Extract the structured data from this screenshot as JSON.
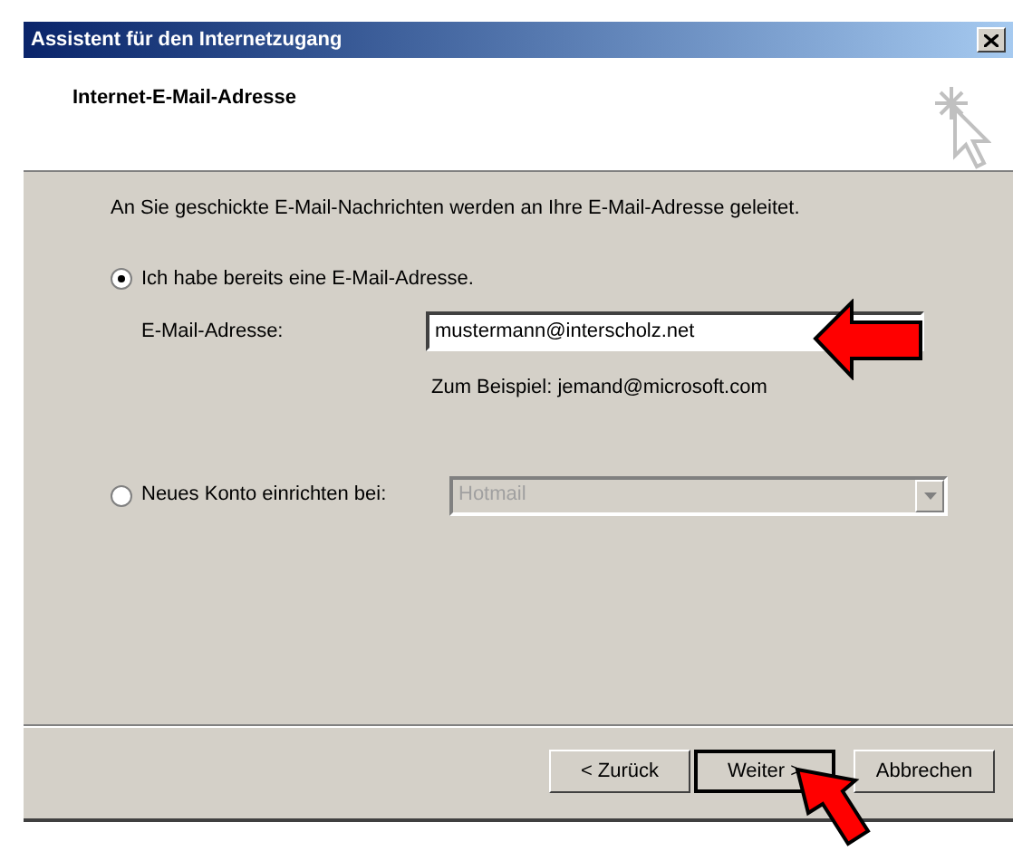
{
  "window": {
    "title": "Assistent für den Internetzugang"
  },
  "header": {
    "title": "Internet-E-Mail-Adresse"
  },
  "intro": "An Sie geschickte E-Mail-Nachrichten werden an Ihre E-Mail-Adresse geleitet.",
  "options": [
    {
      "kind": "existing",
      "label": "Ich habe bereits eine E-Mail-Adresse.",
      "selected": true,
      "field_label": "E-Mail-Adresse:",
      "value": "mustermann@interscholz.net",
      "example": "Zum Beispiel: jemand@microsoft.com"
    },
    {
      "kind": "new",
      "label": "Neues Konto einrichten bei:",
      "selected": false,
      "dropdown": {
        "value": "Hotmail",
        "disabled": true
      }
    }
  ],
  "buttons": [
    {
      "label": "< Zurück",
      "default": false
    },
    {
      "label": "Weiter >",
      "default": true
    },
    {
      "label": "Abbrechen",
      "default": false
    }
  ]
}
